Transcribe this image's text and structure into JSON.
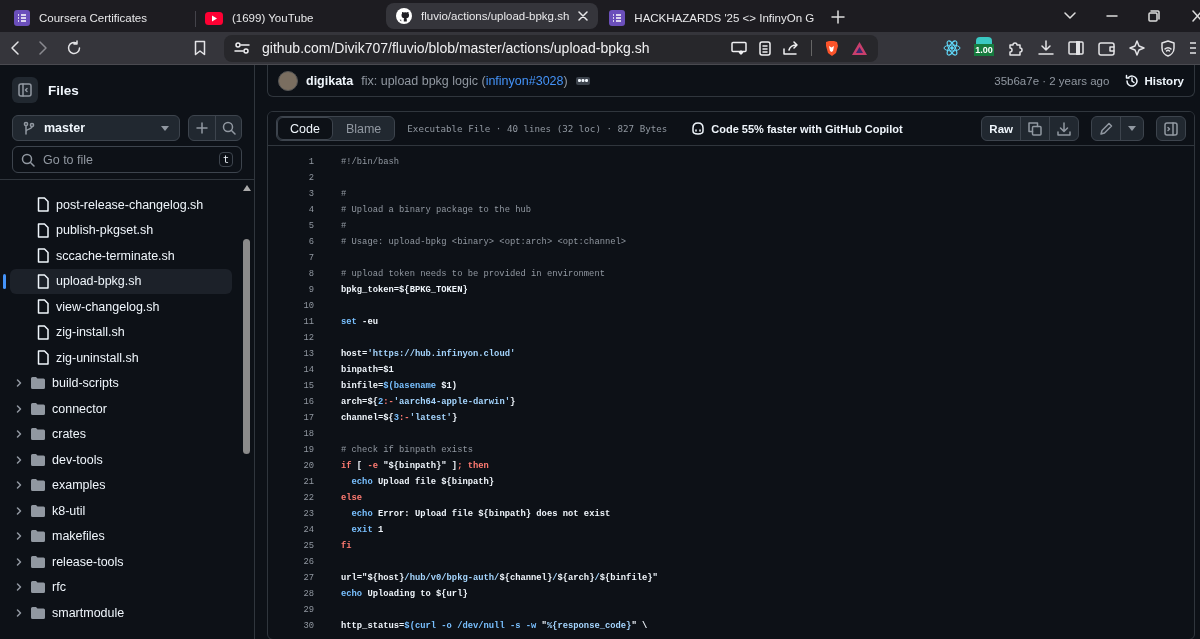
{
  "browser": {
    "tabs": [
      {
        "title": "Coursera Certificates",
        "kind": "list",
        "selected": false
      },
      {
        "title": "(1699) YouTube",
        "kind": "video",
        "selected": false
      },
      {
        "title": "fluvio/actions/upload-bpkg.sh",
        "kind": "github",
        "selected": true
      },
      {
        "title": "HACKHAZARDS '25 <> InfinyOn G",
        "kind": "list",
        "selected": false
      }
    ],
    "url": "github.com/Divik707/fluvio/blob/master/actions/upload-bpkg.sh",
    "extension_badge": "1.00"
  },
  "sidebar": {
    "title": "Files",
    "branch": "master",
    "search": {
      "placeholder": "Go to file",
      "shortcut": "t"
    },
    "tree": {
      "open_folder_files": [
        {
          "name": "post-release-changelog.sh",
          "selected": false
        },
        {
          "name": "publish-pkgset.sh",
          "selected": false
        },
        {
          "name": "sccache-terminate.sh",
          "selected": false
        },
        {
          "name": "upload-bpkg.sh",
          "selected": true
        },
        {
          "name": "view-changelog.sh",
          "selected": false
        },
        {
          "name": "zig-install.sh",
          "selected": false
        },
        {
          "name": "zig-uninstall.sh",
          "selected": false
        }
      ],
      "folders": [
        {
          "name": "build-scripts",
          "expanded": false
        },
        {
          "name": "connector",
          "expanded": false
        },
        {
          "name": "crates",
          "expanded": false
        },
        {
          "name": "dev-tools",
          "expanded": false
        },
        {
          "name": "examples",
          "expanded": false
        },
        {
          "name": "k8-util",
          "expanded": false
        },
        {
          "name": "makefiles",
          "expanded": false
        },
        {
          "name": "release-tools",
          "expanded": false
        },
        {
          "name": "rfc",
          "expanded": false
        },
        {
          "name": "smartmodule",
          "expanded": false
        }
      ]
    }
  },
  "commit": {
    "author": "digikata",
    "message": "fix: upload bpkg logic (",
    "link": "infinyon#3028",
    "message_end": ")",
    "sha_time": "35b6a7e · 2 years ago",
    "history": "History"
  },
  "file_header": {
    "tabs": [
      {
        "label": "Code",
        "selected": true
      },
      {
        "label": "Blame",
        "selected": false
      }
    ],
    "info": "Executable File · 40 lines (32 loc) · 827 Bytes",
    "copilot": "Code 55% faster with GitHub Copilot",
    "raw": "Raw"
  },
  "code": {
    "lines": [
      {
        "n": "1",
        "tokens": [
          {
            "kind": "comment",
            "text": "#!/bin/bash"
          }
        ]
      },
      {
        "n": "2"
      },
      {
        "n": "3",
        "tokens": [
          {
            "kind": "comment",
            "text": "#"
          }
        ]
      },
      {
        "n": "4",
        "tokens": [
          {
            "kind": "comment",
            "text": "# Upload a binary package to the hub"
          }
        ]
      },
      {
        "n": "5",
        "tokens": [
          {
            "kind": "comment",
            "text": "#"
          }
        ]
      },
      {
        "n": "6",
        "tokens": [
          {
            "kind": "comment",
            "text": "# Usage: upload-bpkg <binary> <opt:arch> <opt:channel>"
          }
        ]
      },
      {
        "n": "7"
      },
      {
        "n": "8",
        "tokens": [
          {
            "kind": "comment",
            "text": "# upload token needs to be provided in environment"
          }
        ]
      },
      {
        "n": "9",
        "tokens": [
          {
            "kind": "plain",
            "text": "bpkg_token=${BPKG_TOKEN}"
          }
        ]
      },
      {
        "n": "10"
      },
      {
        "n": "11",
        "tokens": [
          {
            "kind": "builtin",
            "text": "set"
          },
          {
            "kind": "plain",
            "text": " -eu"
          }
        ]
      },
      {
        "n": "12"
      },
      {
        "n": "13",
        "tokens": [
          {
            "kind": "plain",
            "text": "host="
          },
          {
            "kind": "string",
            "text": "'https://hub.infinyon.cloud'"
          }
        ]
      },
      {
        "n": "14",
        "tokens": [
          {
            "kind": "plain",
            "text": "binpath=$1"
          }
        ]
      },
      {
        "n": "15",
        "tokens": [
          {
            "kind": "plain",
            "text": "binfile="
          },
          {
            "kind": "builtin",
            "text": "$(basename"
          },
          {
            "kind": "plain",
            "text": " $1)"
          }
        ]
      },
      {
        "n": "16",
        "tokens": [
          {
            "kind": "plain",
            "text": "arch=${"
          },
          {
            "kind": "builtin",
            "text": "2"
          },
          {
            "kind": "keyword",
            "text": ":-"
          },
          {
            "kind": "string",
            "text": "'aarch64-apple-darwin'"
          },
          {
            "kind": "plain",
            "text": "}"
          }
        ]
      },
      {
        "n": "17",
        "tokens": [
          {
            "kind": "plain",
            "text": "channel=${"
          },
          {
            "kind": "builtin",
            "text": "3"
          },
          {
            "kind": "keyword",
            "text": ":-"
          },
          {
            "kind": "string",
            "text": "'latest'"
          },
          {
            "kind": "plain",
            "text": "}"
          }
        ]
      },
      {
        "n": "18"
      },
      {
        "n": "19",
        "tokens": [
          {
            "kind": "comment",
            "text": "# check if binpath exists"
          }
        ]
      },
      {
        "n": "20",
        "tokens": [
          {
            "kind": "keyword",
            "text": "if"
          },
          {
            "kind": "plain",
            "text": " [ "
          },
          {
            "kind": "keyword",
            "text": "-e"
          },
          {
            "kind": "plain",
            "text": " \"${binpath}\" ]"
          },
          {
            "kind": "keyword",
            "text": "; then"
          }
        ]
      },
      {
        "n": "21",
        "tokens": [
          {
            "kind": "builtin",
            "text": "  echo"
          },
          {
            "kind": "plain",
            "text": " Upload file ${binpath}"
          }
        ]
      },
      {
        "n": "22",
        "tokens": [
          {
            "kind": "keyword",
            "text": "else"
          }
        ]
      },
      {
        "n": "23",
        "tokens": [
          {
            "kind": "builtin",
            "text": "  echo"
          },
          {
            "kind": "plain",
            "text": " Error: Upload file ${binpath} does not exist"
          }
        ]
      },
      {
        "n": "24",
        "tokens": [
          {
            "kind": "builtin",
            "text": "  exit"
          },
          {
            "kind": "plain",
            "text": " 1"
          }
        ]
      },
      {
        "n": "25",
        "tokens": [
          {
            "kind": "keyword",
            "text": "fi"
          }
        ]
      },
      {
        "n": "26"
      },
      {
        "n": "27",
        "tokens": [
          {
            "kind": "plain",
            "text": "url=\"${host}"
          },
          {
            "kind": "string",
            "text": "/hub/v0/bpkg-auth/"
          },
          {
            "kind": "plain",
            "text": "${channel}"
          },
          {
            "kind": "string",
            "text": "/"
          },
          {
            "kind": "plain",
            "text": "${arch}"
          },
          {
            "kind": "string",
            "text": "/"
          },
          {
            "kind": "plain",
            "text": "${binfile}\""
          }
        ]
      },
      {
        "n": "28",
        "tokens": [
          {
            "kind": "builtin",
            "text": "echo"
          },
          {
            "kind": "plain",
            "text": " Uploading to ${url}"
          }
        ]
      },
      {
        "n": "29"
      },
      {
        "n": "30",
        "tokens": [
          {
            "kind": "plain",
            "text": "http_status="
          },
          {
            "kind": "builtin",
            "text": "$(curl -o /dev/null -s -w"
          },
          {
            "kind": "plain",
            "text": " \""
          },
          {
            "kind": "string",
            "text": "%{response_code}"
          },
          {
            "kind": "plain",
            "text": "\" \\"
          }
        ]
      }
    ]
  }
}
